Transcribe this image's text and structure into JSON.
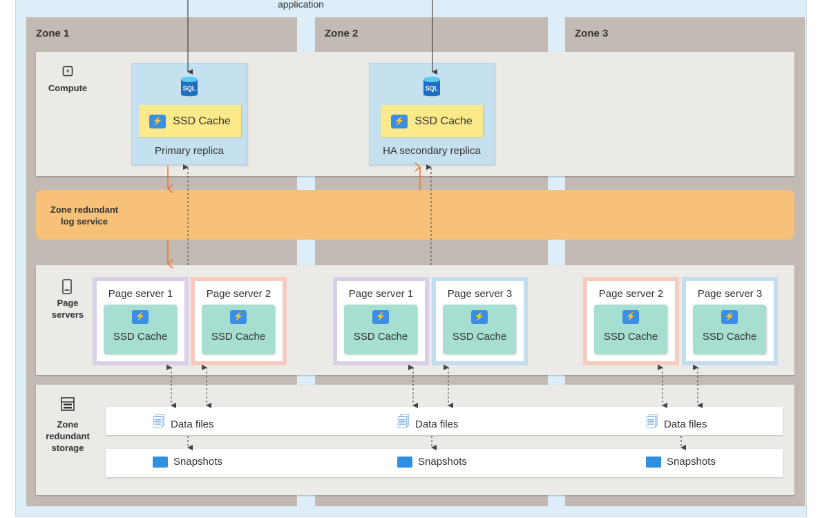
{
  "top_text": "application",
  "zones": [
    "Zone 1",
    "Zone 2",
    "Zone 3"
  ],
  "layers": {
    "compute": "Compute",
    "log_service": "Zone redundant log service",
    "page_servers": "Page servers",
    "storage": "Zone redundant storage"
  },
  "replicas": [
    {
      "label": "Primary replica",
      "cache": "SSD Cache",
      "icon": "sql-database-icon"
    },
    {
      "label": "HA secondary replica",
      "cache": "SSD Cache",
      "icon": "sql-database-icon"
    }
  ],
  "page_servers": [
    {
      "zone": "Zone 1",
      "name": "Page server 1",
      "cache": "SSD Cache",
      "border": "#d9cfe8"
    },
    {
      "zone": "Zone 1",
      "name": "Page server 2",
      "cache": "SSD Cache",
      "border": "#f6cbbe"
    },
    {
      "zone": "Zone 2",
      "name": "Page server 1",
      "cache": "SSD Cache",
      "border": "#d9cfe8"
    },
    {
      "zone": "Zone 2",
      "name": "Page server 3",
      "cache": "SSD Cache",
      "border": "#c3dcee"
    },
    {
      "zone": "Zone 3",
      "name": "Page server 2",
      "cache": "SSD Cache",
      "border": "#f6cbbe"
    },
    {
      "zone": "Zone 3",
      "name": "Page server 3",
      "cache": "SSD Cache",
      "border": "#c3dcee"
    }
  ],
  "storage": {
    "data_files": [
      "Data files",
      "Data files",
      "Data files"
    ],
    "snapshots": [
      "Snapshots",
      "Snapshots",
      "Snapshots"
    ]
  },
  "colors": {
    "zone": "#c2bab3",
    "log_service": "#f7c17a",
    "replica": "#c5e0ef",
    "ssd_cache_compute": "#fbe98a",
    "ssd_cache_page": "#a6ded2",
    "arrow_log": "#e8742f"
  }
}
